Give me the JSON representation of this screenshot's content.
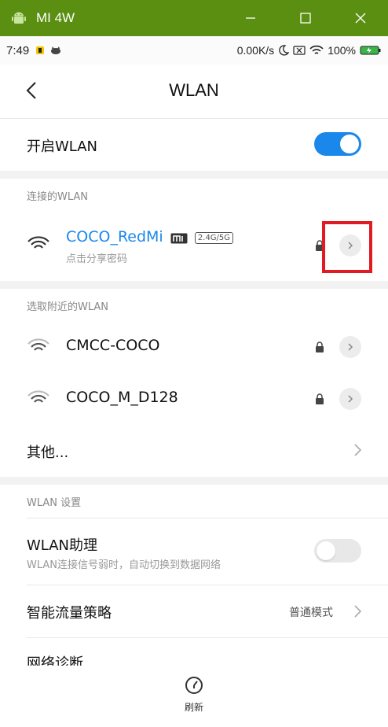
{
  "window": {
    "title": "MI 4W"
  },
  "status_bar": {
    "time": "7:49",
    "speed": "0.00K/s",
    "battery": "100%"
  },
  "header": {
    "title": "WLAN"
  },
  "wlan_toggle": {
    "label": "开启WLAN",
    "state": "on"
  },
  "connected_section": {
    "header": "连接的WLAN",
    "network": {
      "name": "COCO_RedMi",
      "brand_badge": "mi",
      "band_badge": "2.4G/5G",
      "subtitle": "点击分享密码",
      "secured": true
    }
  },
  "nearby_section": {
    "header": "选取附近的WLAN",
    "networks": [
      {
        "name": "CMCC-COCO",
        "secured": true
      },
      {
        "name": "COCO_M_D128",
        "secured": true
      }
    ],
    "other_label": "其他..."
  },
  "settings_section": {
    "header": "WLAN 设置",
    "assistant": {
      "label": "WLAN助理",
      "subtitle": "WLAN连接信号弱时，自动切换到数据网络",
      "state": "off"
    },
    "traffic_policy": {
      "label": "智能流量策略",
      "value": "普通模式"
    },
    "diagnostics": {
      "label": "网络诊断"
    }
  },
  "bottom_bar": {
    "refresh_label": "刷新"
  },
  "colors": {
    "titlebar": "#5a8f12",
    "accent": "#1a87ea",
    "highlight": "#e01b24"
  }
}
